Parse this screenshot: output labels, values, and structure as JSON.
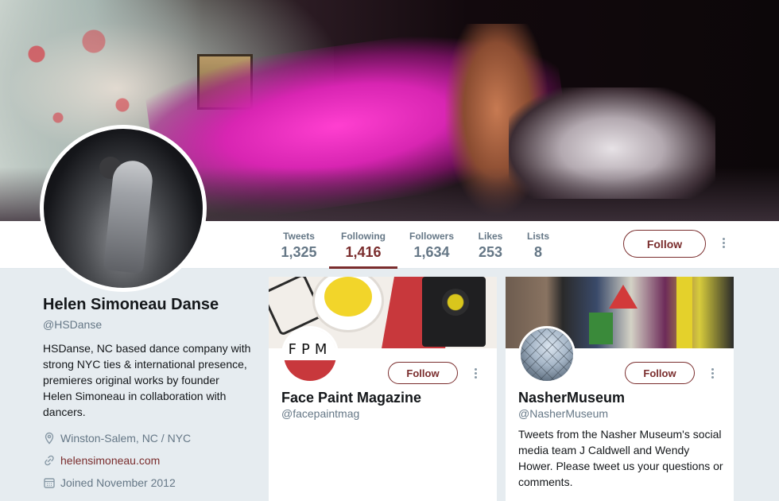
{
  "stats": [
    {
      "label": "Tweets",
      "value": "1,325"
    },
    {
      "label": "Following",
      "value": "1,416"
    },
    {
      "label": "Followers",
      "value": "1,634"
    },
    {
      "label": "Likes",
      "value": "253"
    },
    {
      "label": "Lists",
      "value": "8"
    }
  ],
  "active_stat": "Following",
  "header": {
    "follow_label": "Follow"
  },
  "profile": {
    "name": "Helen Simoneau Danse",
    "handle": "@HSDanse",
    "bio": "HSDanse, NC based dance company with strong NYC ties & international presence, premieres original works by founder Helen Simoneau in collaboration with dancers.",
    "location": "Winston-Salem, NC / NYC",
    "website": "helensimoneau.com",
    "joined": "Joined November 2012"
  },
  "cards": [
    {
      "name": "Face Paint Magazine",
      "handle": "@facepaintmag",
      "bio": "",
      "avatar_text": "FPM",
      "follow_label": "Follow"
    },
    {
      "name": "NasherMuseum",
      "handle": "@NasherMuseum",
      "bio": "Tweets from the Nasher Museum's social media team J Caldwell and Wendy Hower. Please tweet us your questions or comments.",
      "follow_label": "Follow"
    }
  ],
  "colors": {
    "accent": "#7a2d2d",
    "muted": "#657786",
    "background": "#e6ecf0"
  },
  "icons": [
    "location-icon",
    "link-icon",
    "calendar-icon",
    "more-icon"
  ]
}
